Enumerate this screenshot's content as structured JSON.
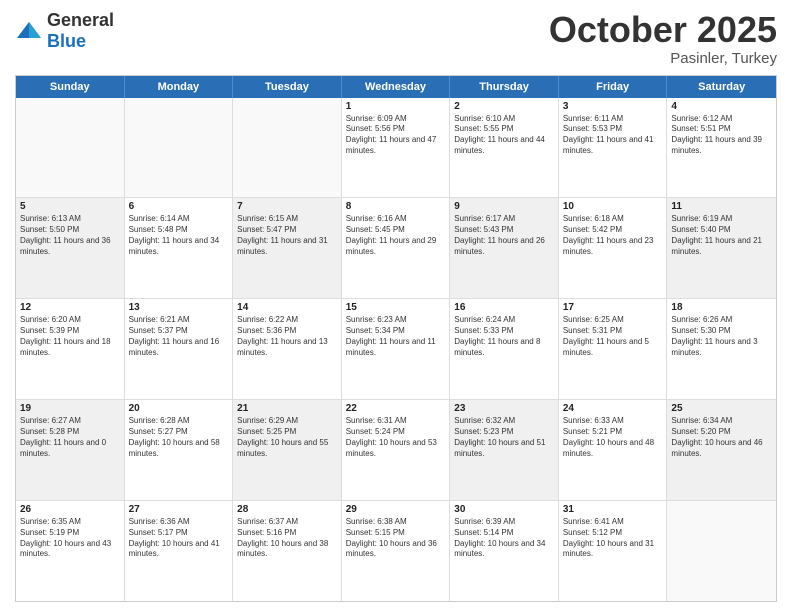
{
  "header": {
    "logo": {
      "general": "General",
      "blue": "Blue"
    },
    "month": "October 2025",
    "location": "Pasinler, Turkey"
  },
  "weekdays": [
    "Sunday",
    "Monday",
    "Tuesday",
    "Wednesday",
    "Thursday",
    "Friday",
    "Saturday"
  ],
  "rows": [
    [
      {
        "day": "",
        "empty": true
      },
      {
        "day": "",
        "empty": true
      },
      {
        "day": "",
        "empty": true
      },
      {
        "day": "1",
        "sunrise": "6:09 AM",
        "sunset": "5:56 PM",
        "daylight": "11 hours and 47 minutes."
      },
      {
        "day": "2",
        "sunrise": "6:10 AM",
        "sunset": "5:55 PM",
        "daylight": "11 hours and 44 minutes."
      },
      {
        "day": "3",
        "sunrise": "6:11 AM",
        "sunset": "5:53 PM",
        "daylight": "11 hours and 41 minutes."
      },
      {
        "day": "4",
        "sunrise": "6:12 AM",
        "sunset": "5:51 PM",
        "daylight": "11 hours and 39 minutes."
      }
    ],
    [
      {
        "day": "5",
        "sunrise": "6:13 AM",
        "sunset": "5:50 PM",
        "daylight": "11 hours and 36 minutes."
      },
      {
        "day": "6",
        "sunrise": "6:14 AM",
        "sunset": "5:48 PM",
        "daylight": "11 hours and 34 minutes."
      },
      {
        "day": "7",
        "sunrise": "6:15 AM",
        "sunset": "5:47 PM",
        "daylight": "11 hours and 31 minutes."
      },
      {
        "day": "8",
        "sunrise": "6:16 AM",
        "sunset": "5:45 PM",
        "daylight": "11 hours and 29 minutes."
      },
      {
        "day": "9",
        "sunrise": "6:17 AM",
        "sunset": "5:43 PM",
        "daylight": "11 hours and 26 minutes."
      },
      {
        "day": "10",
        "sunrise": "6:18 AM",
        "sunset": "5:42 PM",
        "daylight": "11 hours and 23 minutes."
      },
      {
        "day": "11",
        "sunrise": "6:19 AM",
        "sunset": "5:40 PM",
        "daylight": "11 hours and 21 minutes."
      }
    ],
    [
      {
        "day": "12",
        "sunrise": "6:20 AM",
        "sunset": "5:39 PM",
        "daylight": "11 hours and 18 minutes."
      },
      {
        "day": "13",
        "sunrise": "6:21 AM",
        "sunset": "5:37 PM",
        "daylight": "11 hours and 16 minutes."
      },
      {
        "day": "14",
        "sunrise": "6:22 AM",
        "sunset": "5:36 PM",
        "daylight": "11 hours and 13 minutes."
      },
      {
        "day": "15",
        "sunrise": "6:23 AM",
        "sunset": "5:34 PM",
        "daylight": "11 hours and 11 minutes."
      },
      {
        "day": "16",
        "sunrise": "6:24 AM",
        "sunset": "5:33 PM",
        "daylight": "11 hours and 8 minutes."
      },
      {
        "day": "17",
        "sunrise": "6:25 AM",
        "sunset": "5:31 PM",
        "daylight": "11 hours and 5 minutes."
      },
      {
        "day": "18",
        "sunrise": "6:26 AM",
        "sunset": "5:30 PM",
        "daylight": "11 hours and 3 minutes."
      }
    ],
    [
      {
        "day": "19",
        "sunrise": "6:27 AM",
        "sunset": "5:28 PM",
        "daylight": "11 hours and 0 minutes."
      },
      {
        "day": "20",
        "sunrise": "6:28 AM",
        "sunset": "5:27 PM",
        "daylight": "10 hours and 58 minutes."
      },
      {
        "day": "21",
        "sunrise": "6:29 AM",
        "sunset": "5:25 PM",
        "daylight": "10 hours and 55 minutes."
      },
      {
        "day": "22",
        "sunrise": "6:31 AM",
        "sunset": "5:24 PM",
        "daylight": "10 hours and 53 minutes."
      },
      {
        "day": "23",
        "sunrise": "6:32 AM",
        "sunset": "5:23 PM",
        "daylight": "10 hours and 51 minutes."
      },
      {
        "day": "24",
        "sunrise": "6:33 AM",
        "sunset": "5:21 PM",
        "daylight": "10 hours and 48 minutes."
      },
      {
        "day": "25",
        "sunrise": "6:34 AM",
        "sunset": "5:20 PM",
        "daylight": "10 hours and 46 minutes."
      }
    ],
    [
      {
        "day": "26",
        "sunrise": "6:35 AM",
        "sunset": "5:19 PM",
        "daylight": "10 hours and 43 minutes."
      },
      {
        "day": "27",
        "sunrise": "6:36 AM",
        "sunset": "5:17 PM",
        "daylight": "10 hours and 41 minutes."
      },
      {
        "day": "28",
        "sunrise": "6:37 AM",
        "sunset": "5:16 PM",
        "daylight": "10 hours and 38 minutes."
      },
      {
        "day": "29",
        "sunrise": "6:38 AM",
        "sunset": "5:15 PM",
        "daylight": "10 hours and 36 minutes."
      },
      {
        "day": "30",
        "sunrise": "6:39 AM",
        "sunset": "5:14 PM",
        "daylight": "10 hours and 34 minutes."
      },
      {
        "day": "31",
        "sunrise": "6:41 AM",
        "sunset": "5:12 PM",
        "daylight": "10 hours and 31 minutes."
      },
      {
        "day": "",
        "empty": true
      }
    ]
  ]
}
